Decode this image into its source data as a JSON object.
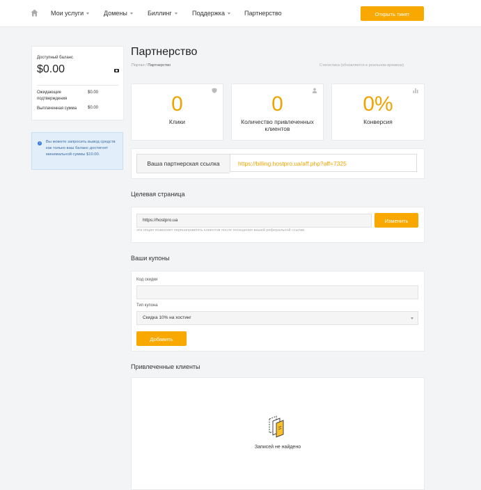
{
  "nav": {
    "items": [
      {
        "label": "Мои услуги",
        "dropdown": true
      },
      {
        "label": "Домены",
        "dropdown": true
      },
      {
        "label": "Биллинг",
        "dropdown": true
      },
      {
        "label": "Поддержка",
        "dropdown": true
      },
      {
        "label": "Партнерство",
        "dropdown": false
      }
    ],
    "ticket_button": "Открыть тикет"
  },
  "balance": {
    "label": "Доступный баланс",
    "amount": "$0.00",
    "pending_label": "Ожидающие подтверждения",
    "pending_value": "$0.00",
    "paid_label": "Выплаченная сумма",
    "paid_value": "$0.00"
  },
  "info_text": "Вы можете запросить вывод средств как только ваш баланс достигнет минимальной суммы $10.00.",
  "page": {
    "title": "Партнерство",
    "breadcrumb_home": "Портал",
    "breadcrumb_current": "Партнерство",
    "stats_note": "Статистика (обновляется в реальном времени)"
  },
  "stats": [
    {
      "value": "0",
      "label": "Клики",
      "icon": "shield-icon"
    },
    {
      "value": "0",
      "label": "Количество привлеченных клиентов",
      "icon": "user-icon"
    },
    {
      "value": "0%",
      "label": "Конверсия",
      "icon": "bar-chart-icon"
    }
  ],
  "referral": {
    "label": "Ваша партнерская ссылка",
    "link": "https://billing.hostpro.ua/aff.php?aff=7325"
  },
  "landing": {
    "title": "Целевая страница",
    "url": "https://hostpro.ua",
    "button": "Изменить",
    "hint": "эта опция позволяет перенаправлять клиентов после посещения вашей реферальной ссылки"
  },
  "coupons": {
    "title": "Ваши купоны",
    "code_label": "Код скидки",
    "code_value": "",
    "type_label": "Тип купона",
    "type_value": "Скидка 10% на хостинг",
    "add_button": "Добавить"
  },
  "clients": {
    "title": "Привлеченные клиенты",
    "empty_text": "Записей не найдено",
    "empty_icon": "files-icon"
  },
  "colors": {
    "accent": "#f9a800",
    "accent_text": "#f0a400",
    "info_bg": "#e3eefb"
  }
}
